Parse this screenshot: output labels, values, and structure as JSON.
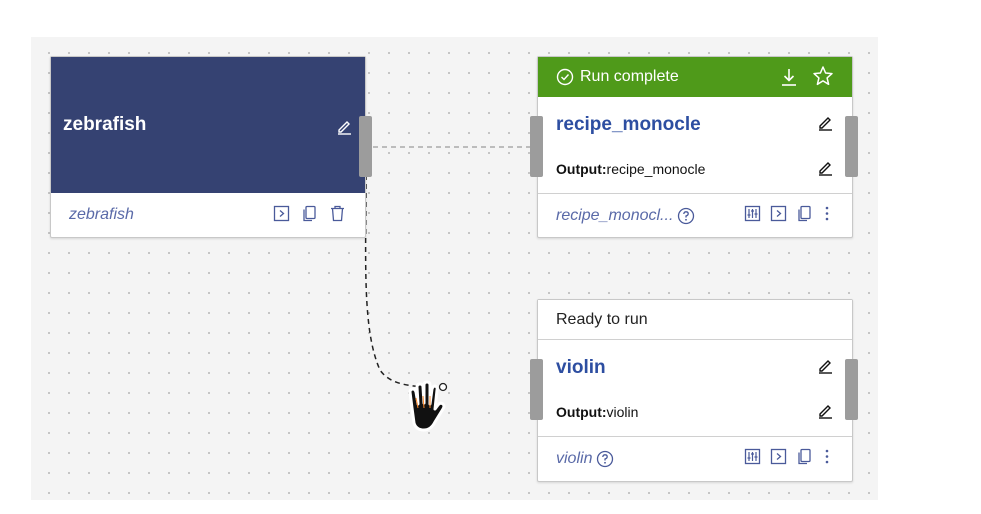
{
  "colors": {
    "dataset_header": "#354272",
    "run_complete": "#4f9a1a",
    "recipe_title": "#2d4ea1",
    "handle": "#9c9c9c",
    "canvas": "#f4f4f4"
  },
  "dataset": {
    "title": "zebrafish",
    "subtitle": "zebrafish",
    "icons": [
      "edit-icon",
      "open-icon",
      "copy-icon",
      "trash-icon"
    ]
  },
  "recipes": [
    {
      "status": "Run complete",
      "title": "recipe_monocle",
      "output_label": "Output:",
      "output_value": "recipe_monocle",
      "subtitle": "recipe_monocl...",
      "icons": [
        "check-circle-icon",
        "download-icon",
        "star-icon",
        "edit-icon",
        "help-icon",
        "settings-icon",
        "open-icon",
        "copy-icon",
        "more-icon"
      ]
    },
    {
      "status": "Ready to run",
      "title": "violin",
      "output_label": "Output:",
      "output_value": "violin",
      "subtitle": "violin",
      "icons": [
        "edit-icon",
        "help-icon",
        "settings-icon",
        "open-icon",
        "copy-icon",
        "more-icon"
      ]
    }
  ],
  "cursor": {
    "icon": "grab-hand-icon"
  }
}
